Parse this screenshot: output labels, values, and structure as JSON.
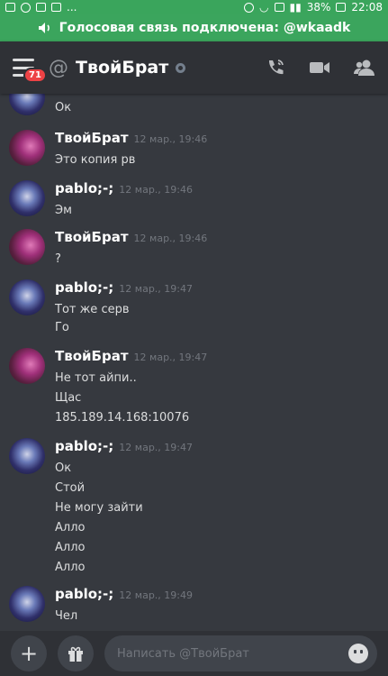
{
  "statusbar": {
    "leading": "...",
    "battery": "38%",
    "time": "22:08"
  },
  "voice": {
    "text": "Голосовая связь подключена: @wkaadk"
  },
  "header": {
    "badge": "71",
    "at": "@",
    "name": "ТвойБрат"
  },
  "partial": {
    "text": "Ок"
  },
  "messages": [
    {
      "user": "ТвойБрат",
      "ts": "12 мар., 19:46",
      "lines": [
        "Это копия рв"
      ]
    },
    {
      "user": "pablo;-;",
      "ts": "12 мар., 19:46",
      "lines": [
        "Эм"
      ]
    },
    {
      "user": "ТвойБрат",
      "ts": "12 мар., 19:46",
      "lines": [
        "?"
      ]
    },
    {
      "user": "pablo;-;",
      "ts": "12 мар., 19:47",
      "lines": [
        "Тот же серв",
        "Го"
      ]
    },
    {
      "user": "ТвойБрат",
      "ts": "12 мар., 19:47",
      "lines": [
        "Не тот айпи..",
        "Щас",
        "185.189.14.168:10076"
      ]
    },
    {
      "user": "pablo;-;",
      "ts": "12 мар., 19:47",
      "lines": [
        "Ок",
        "Стой",
        "Не могу зайти",
        "Алло",
        "Алло",
        "Алло"
      ]
    },
    {
      "user": "pablo;-;",
      "ts": "12 мар., 19:49",
      "lines": [
        "Чел"
      ]
    }
  ],
  "composer": {
    "placeholder": "Написать @ТвойБрат",
    "add": "+"
  }
}
